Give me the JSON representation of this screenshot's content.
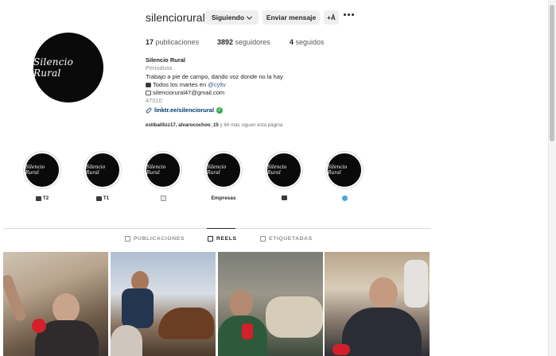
{
  "header": {
    "username": "silenciorural",
    "follow_button": "Siguiendo",
    "message_button": "Enviar mensaje",
    "suggest_button": "+Å"
  },
  "avatar": {
    "logo_text": "Silencio Rural"
  },
  "stats": {
    "posts_count": "17",
    "posts_label": "publicaciones",
    "followers_count": "3892",
    "followers_label": "seguidores",
    "following_count": "4",
    "following_label": "seguidos"
  },
  "bio": {
    "name": "Silencio Rural",
    "category": "Periodista",
    "line1": "Trabajo a pie de campo, dando voz donde no la hay",
    "line2_prefix": "Todos los martes en ",
    "line2_mention": "@cyltv",
    "email": "silenciorural47@gmail.com",
    "postal": "47010",
    "link": "linktr.ee/silenciorural"
  },
  "followed_by": {
    "names": "estibalilizz17, alvarocochoo_15",
    "suffix": " y 84 más siguen esta página"
  },
  "highlights": [
    {
      "label": "T2",
      "icon": "tv-icon"
    },
    {
      "label": "T1",
      "icon": "tv-icon"
    },
    {
      "label": "",
      "icon": "box-icon"
    },
    {
      "label": "Empresas",
      "icon": ""
    },
    {
      "label": "",
      "icon": "card-icon"
    },
    {
      "label": "",
      "icon": "globe-icon"
    }
  ],
  "highlight_logo": "Silencio Rural",
  "tabs": {
    "posts": "PUBLICACIONES",
    "reels": "REELS",
    "tagged": "ETIQUETADAS",
    "active": "REELS"
  },
  "colors": {
    "accent_link": "#00376b",
    "mention": "#385898",
    "verified": "#3aa757",
    "button_bg": "#efefef"
  }
}
